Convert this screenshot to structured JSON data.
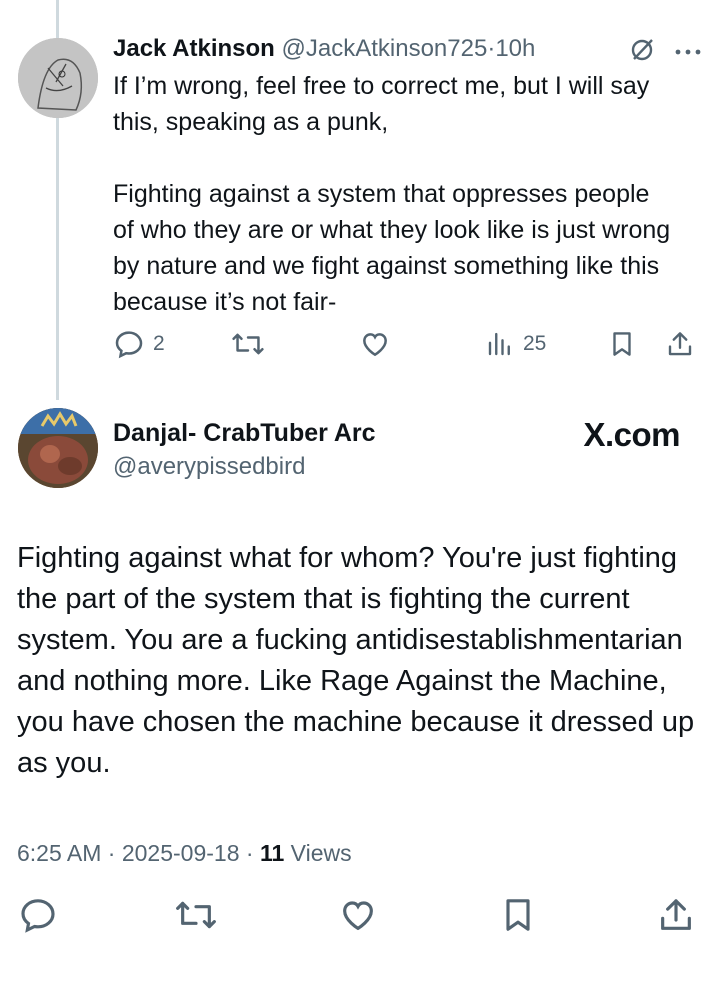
{
  "reply": {
    "name": "Jack Atkinson",
    "handle": "@JackAtkinson725",
    "separator": "·",
    "time": "10h",
    "text": "If I’m wrong, feel free to correct me, but I will say this, speaking as a punk,\n\nFighting against a system that oppresses people of who they are or what they look like is just wrong by nature and we fight against something like this because it’s not fair-",
    "replies_count": "2",
    "views_count": "25",
    "icons": [
      "grok-icon",
      "more-icon",
      "reply-icon",
      "repost-icon",
      "like-icon",
      "views-icon",
      "bookmark-icon",
      "share-icon"
    ]
  },
  "main": {
    "name": "Danjal- CrabTuber Arc",
    "handle": "@averypissedbird",
    "watermark": "X.com",
    "text": "Fighting against what for whom? You're just fighting the part of the system that is fighting the current system. You are a fucking antidisestablishmentarian and nothing more. Like Rage Against the Machine, you have chosen the machine because it dressed up as you.",
    "time": "6:25 AM",
    "date": "2025-09-18",
    "sep1": "·",
    "sep2": "·",
    "views_number": "11",
    "views_label": "Views"
  },
  "colors": {
    "text": "#0f1419",
    "muted": "#536471",
    "thread": "#cfd9de"
  }
}
